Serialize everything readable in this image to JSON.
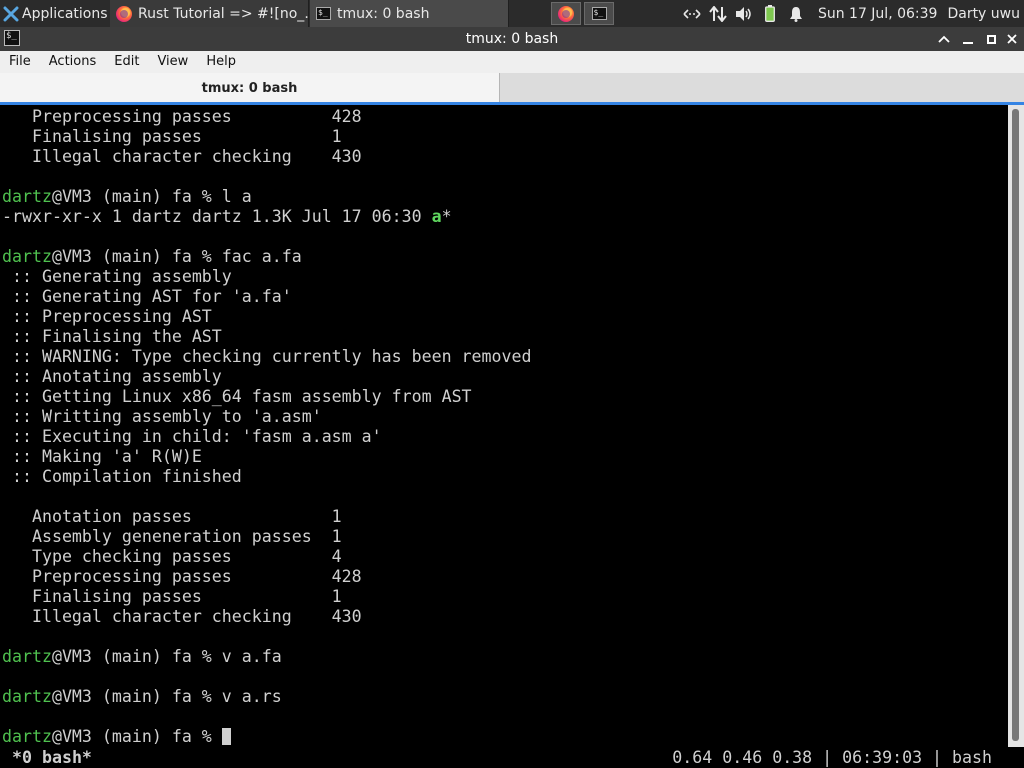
{
  "panel": {
    "apps_label": "Applications",
    "tasks": [
      {
        "label": "Rust Tutorial => #![no_…"
      },
      {
        "label": "tmux: 0 bash"
      }
    ],
    "clock": "Sun 17 Jul, 06:39",
    "user": "Darty uwu"
  },
  "window": {
    "title": "tmux: 0 bash",
    "menu": [
      "File",
      "Actions",
      "Edit",
      "View",
      "Help"
    ],
    "tab_label": "tmux: 0 bash"
  },
  "terminal": {
    "prompt_user": "dartz",
    "prompt_rest": "@VM3 (main) fa % ",
    "lines": [
      {
        "t": "plain",
        "text": "   Preprocessing passes          428"
      },
      {
        "t": "plain",
        "text": "   Finalising passes             1"
      },
      {
        "t": "plain",
        "text": "   Illegal character checking    430"
      },
      {
        "t": "blank",
        "text": ""
      },
      {
        "t": "prompt",
        "text": "l a"
      },
      {
        "t": "ls",
        "text": "-rwxr-xr-x 1 dartz dartz 1.3K Jul 17 06:30 ",
        "name": "a",
        "suffix": "*"
      },
      {
        "t": "blank",
        "text": ""
      },
      {
        "t": "prompt",
        "text": "fac a.fa"
      },
      {
        "t": "plain",
        "text": " :: Generating assembly"
      },
      {
        "t": "plain",
        "text": " :: Generating AST for 'a.fa'"
      },
      {
        "t": "plain",
        "text": " :: Preprocessing AST"
      },
      {
        "t": "plain",
        "text": " :: Finalising the AST"
      },
      {
        "t": "plain",
        "text": " :: WARNING: Type checking currently has been removed"
      },
      {
        "t": "plain",
        "text": " :: Anotating assembly"
      },
      {
        "t": "plain",
        "text": " :: Getting Linux x86_64 fasm assembly from AST"
      },
      {
        "t": "plain",
        "text": " :: Writting assembly to 'a.asm'"
      },
      {
        "t": "plain",
        "text": " :: Executing in child: 'fasm a.asm a'"
      },
      {
        "t": "plain",
        "text": " :: Making 'a' R(W)E"
      },
      {
        "t": "plain",
        "text": " :: Compilation finished"
      },
      {
        "t": "blank",
        "text": ""
      },
      {
        "t": "plain",
        "text": "   Anotation passes              1"
      },
      {
        "t": "plain",
        "text": "   Assembly geneneration passes  1"
      },
      {
        "t": "plain",
        "text": "   Type checking passes          4"
      },
      {
        "t": "plain",
        "text": "   Preprocessing passes          428"
      },
      {
        "t": "plain",
        "text": "   Finalising passes             1"
      },
      {
        "t": "plain",
        "text": "   Illegal character checking    430"
      },
      {
        "t": "blank",
        "text": ""
      },
      {
        "t": "prompt",
        "text": "v a.fa"
      },
      {
        "t": "blank",
        "text": ""
      },
      {
        "t": "prompt",
        "text": "v a.rs"
      },
      {
        "t": "blank",
        "text": ""
      },
      {
        "t": "prompt_cursor",
        "text": ""
      }
    ]
  },
  "tmux": {
    "status_left": "*0 bash*",
    "status_right": "0.64 0.46 0.38 | 06:39:03 | bash"
  },
  "colors": {
    "prompt_user": "#4fc14f",
    "executable": "#5fd75f",
    "tab_accent": "#3584e4"
  }
}
